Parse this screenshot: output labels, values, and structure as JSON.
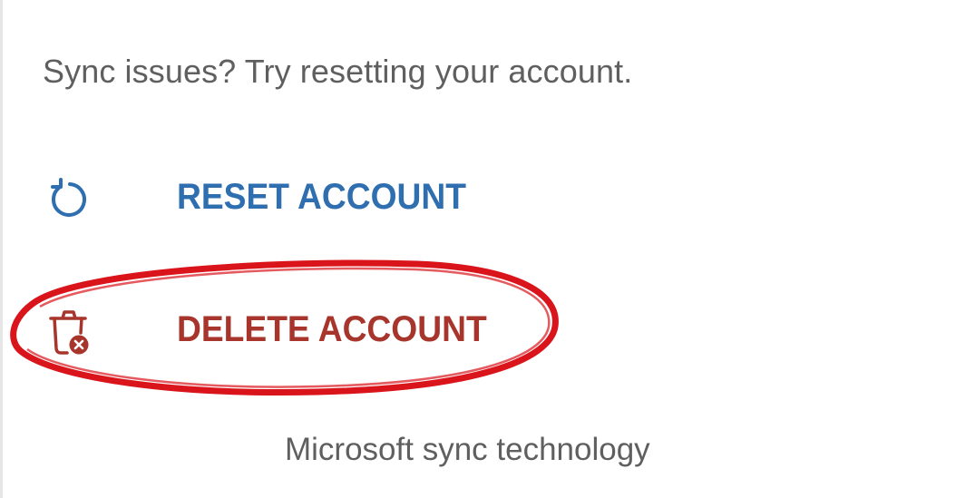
{
  "settings": {
    "sync_hint": "Sync issues? Try resetting your account.",
    "reset_label": "RESET ACCOUNT",
    "delete_label": "DELETE ACCOUNT",
    "footer": "Microsoft sync technology"
  },
  "icons": {
    "reset": "refresh-icon",
    "delete": "trash-delete-icon"
  },
  "colors": {
    "reset_accent": "#2f6fb0",
    "delete_accent": "#a8352c",
    "highlight": "#d9141b",
    "text_secondary": "#5f5f5f"
  }
}
